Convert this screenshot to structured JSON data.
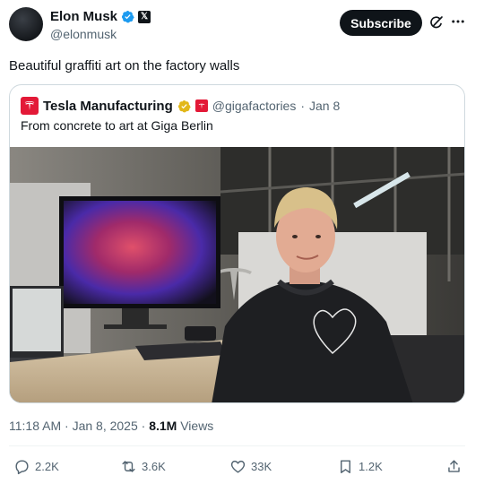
{
  "author": {
    "name": "Elon Musk",
    "handle": "@elonmusk",
    "affiliate_badge": "𝕏"
  },
  "actions_top": {
    "subscribe_label": "Subscribe"
  },
  "tweet": {
    "text": "Beautiful graffiti art on the factory walls"
  },
  "quote": {
    "name": "Tesla Manufacturing",
    "handle": "@gigafactories",
    "sep": "·",
    "date": "Jan 8",
    "text": "From concrete to art at Giga Berlin"
  },
  "meta": {
    "time": "11:18 AM",
    "sep1": "·",
    "date": "Jan 8, 2025",
    "sep2": "·",
    "views_count": "8.1M",
    "views_label": "Views"
  },
  "stats": {
    "replies": "2.2K",
    "reposts": "3.6K",
    "likes": "33K",
    "bookmarks": "1.2K"
  },
  "colors": {
    "verified_blue": "#1d9bf0",
    "gold": "#e2b719",
    "tesla_red": "#e31937",
    "subscribe_bg": "#0f1419"
  }
}
